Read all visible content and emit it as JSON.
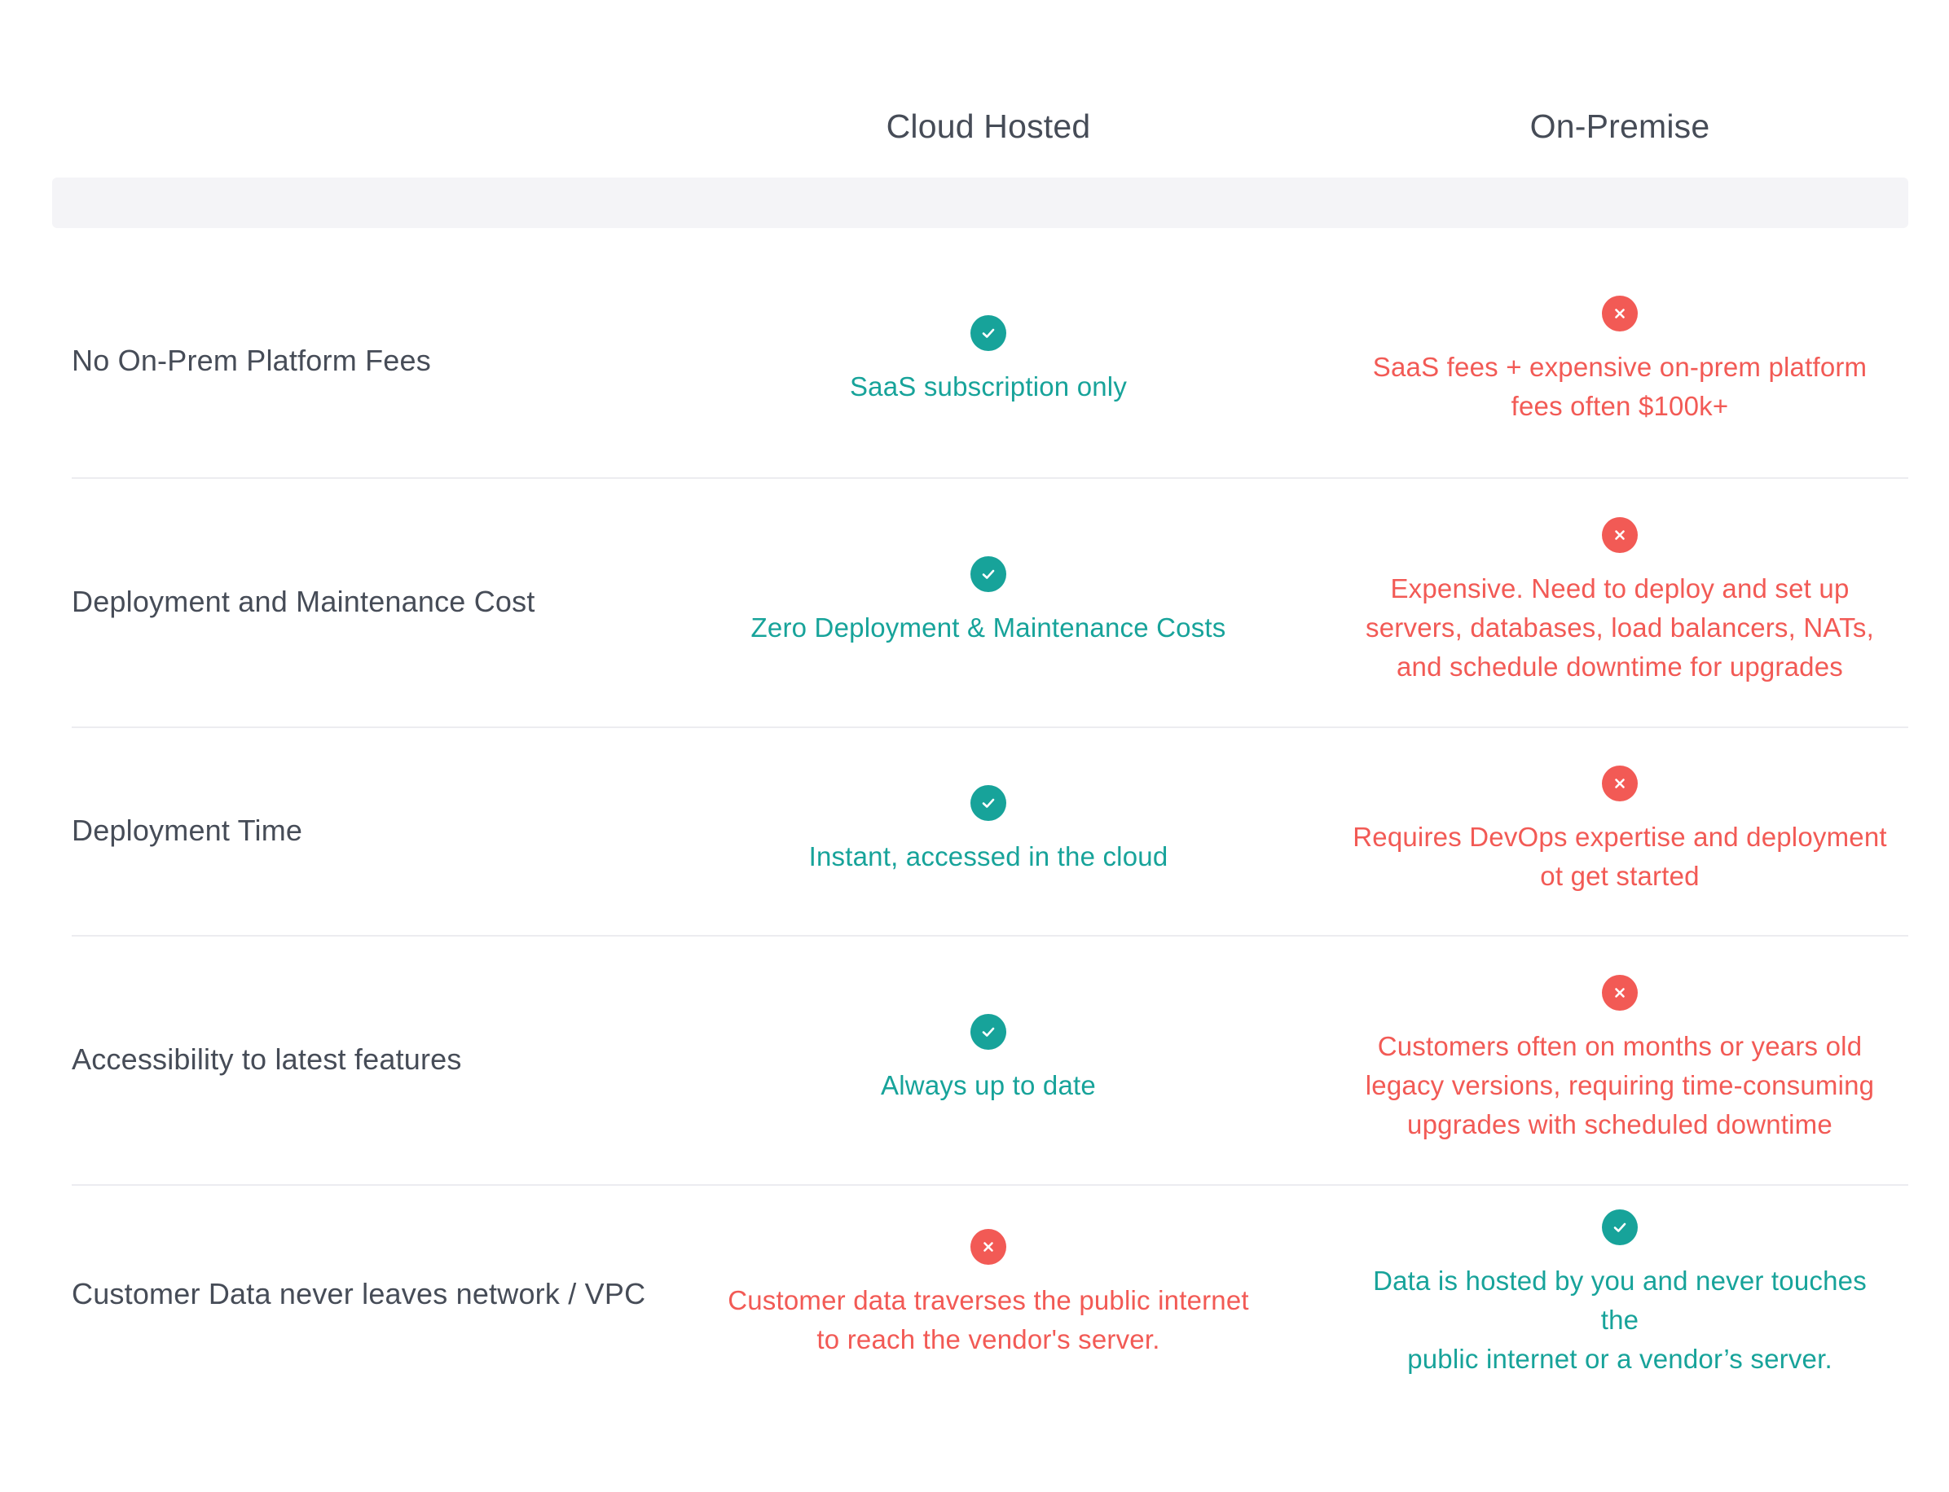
{
  "header": {
    "col1": "Cloud Hosted",
    "col2": "On-Premise"
  },
  "colors": {
    "positive": "#17a39a",
    "negative": "#f25a55",
    "text": "#464c57"
  },
  "rows": [
    {
      "feature": "No On-Prem Platform Fees",
      "cloud": {
        "status": "check-icon",
        "text": "SaaS subscription only"
      },
      "onprem": {
        "status": "x-icon",
        "text": "SaaS fees + expensive on-prem platform\nfees often $100k+"
      }
    },
    {
      "feature": "Deployment and Maintenance Cost",
      "cloud": {
        "status": "check-icon",
        "text": "Zero Deployment & Maintenance Costs"
      },
      "onprem": {
        "status": "x-icon",
        "text": "Expensive. Need to deploy and set up\nservers, databases, load balancers, NATs,\nand schedule downtime for upgrades"
      }
    },
    {
      "feature": "Deployment Time",
      "cloud": {
        "status": "check-icon",
        "text": "Instant, accessed in the cloud"
      },
      "onprem": {
        "status": "x-icon",
        "text": "Requires DevOps expertise and deployment\not get started"
      }
    },
    {
      "feature": "Accessibility to latest features",
      "cloud": {
        "status": "check-icon",
        "text": "Always up to date"
      },
      "onprem": {
        "status": "x-icon",
        "text": "Customers often on months or years old\nlegacy versions, requiring time-consuming\nupgrades with scheduled downtime"
      }
    },
    {
      "feature": "Customer Data never leaves network / VPC",
      "cloud": {
        "status": "x-icon",
        "text": "Customer data traverses the public internet\nto reach the vendor's server."
      },
      "onprem": {
        "status": "check-icon",
        "text": "Data is hosted by you and never touches the\npublic internet or a vendor’s server."
      }
    }
  ]
}
